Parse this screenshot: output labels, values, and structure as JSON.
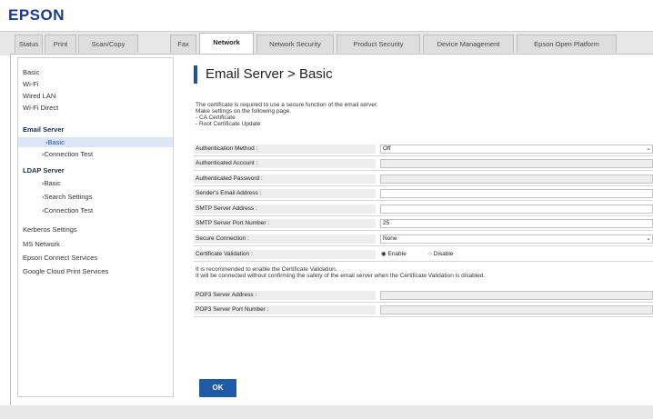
{
  "brand": {
    "logo_text": "EPSON",
    "logo_color": "#1b3a8c",
    "accent": "#1f4fa8"
  },
  "tabs": [
    "Status",
    "Print",
    "Scan/Copy",
    "Fax",
    "Network",
    "Network Security",
    "Product Security",
    "Device Management",
    "Epson Open Platform"
  ],
  "active_tab": "Network",
  "sidebar": {
    "items": [
      {
        "label": "Basic"
      },
      {
        "label": "Wi-Fi"
      },
      {
        "label": "Wired LAN"
      },
      {
        "label": "Wi-Fi Direct"
      },
      {
        "label": "Email Server"
      },
      {
        "label": "›Basic"
      },
      {
        "label": "›Connection Test"
      },
      {
        "label": "LDAP Server"
      },
      {
        "label": "›Basic"
      },
      {
        "label": "›Search Settings"
      },
      {
        "label": "›Connection Test"
      },
      {
        "label": "Kerberos Settings"
      },
      {
        "label": "MS Network"
      },
      {
        "label": "Epson Connect Services"
      },
      {
        "label": "Google Cloud Print Services"
      }
    ],
    "selected": "›Basic"
  },
  "main": {
    "title": "Email Server > Basic",
    "description": [
      "The certificate is required to use a secure function of the email server.",
      "Make settings on the following page.",
      "- CA Certificate",
      "- Root Certificate Update"
    ],
    "fields": [
      {
        "label": "Authentication Method :",
        "value": "Off",
        "type": "select"
      },
      {
        "label": "Authenticated Account :",
        "value": "",
        "type": "text-disabled"
      },
      {
        "label": "Authenticated Password :",
        "value": "",
        "type": "text-disabled"
      },
      {
        "label": "Sender's Email Address :",
        "value": "",
        "type": "text"
      },
      {
        "label": "SMTP Server Address :",
        "value": "",
        "type": "text"
      },
      {
        "label": "SMTP Server Port Number :",
        "value": "25",
        "type": "text"
      },
      {
        "label": "Secure Connection :",
        "value": "None",
        "type": "select"
      }
    ],
    "cert_validation": {
      "label": "Certificate Validation :",
      "enable": "Enable",
      "disable": "Disable",
      "selected": "Enable"
    },
    "notes": [
      "It is recommended to enable the Certificate Validation.",
      "It will be connected without confirming the safety of the email server when the Certificate Validation is disabled."
    ],
    "pop3_fields": [
      {
        "label": "POP3 Server Address :",
        "value": ""
      },
      {
        "label": "POP3 Server Port Number :",
        "value": ""
      }
    ],
    "ok_label": "OK"
  }
}
